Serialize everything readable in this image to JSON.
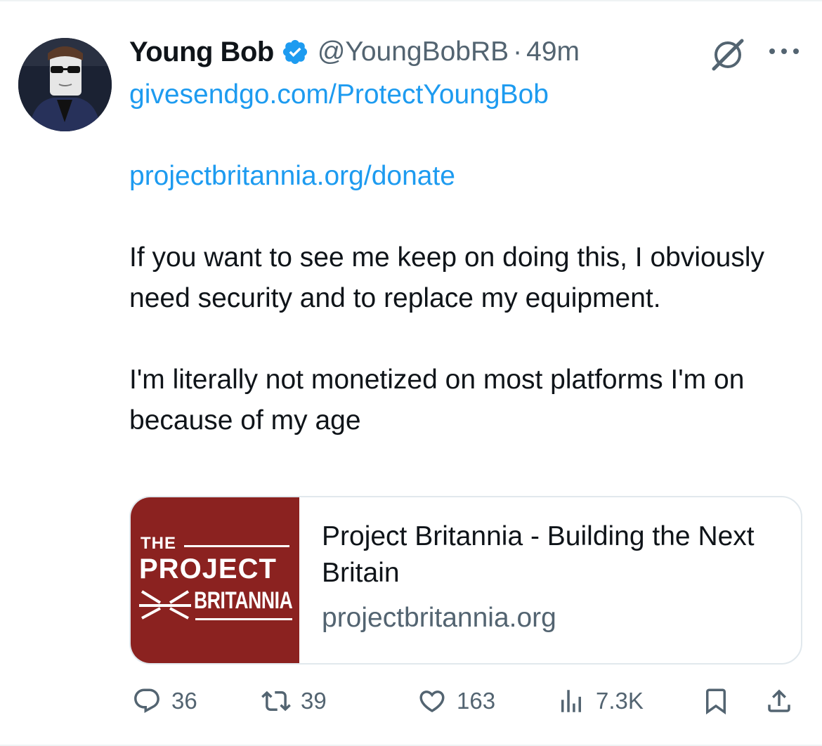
{
  "author": {
    "name": "Young Bob",
    "handle": "@YoungBobRB",
    "separator": "·",
    "time": "49m",
    "verified": true
  },
  "body": {
    "link1": "givesendgo.com/ProtectYoungBob",
    "link2": "projectbritannia.org/donate",
    "para1": "If you want to see me keep on doing this, I obviously need security and to replace my equipment.",
    "para2": "I'm literally not monetized on most platforms I'm on because of my age"
  },
  "card": {
    "logo_the": "THE",
    "logo_project": "PROJECT",
    "logo_britannia": "BRITANNIA",
    "title": "Project Britannia - Building the Next Britain",
    "domain": "projectbritannia.org"
  },
  "actions": {
    "replies": "36",
    "reposts": "39",
    "likes": "163",
    "views": "7.3K"
  },
  "colors": {
    "link": "#1d9bf0",
    "muted": "#536471",
    "card_thumb": "#8b2220"
  }
}
